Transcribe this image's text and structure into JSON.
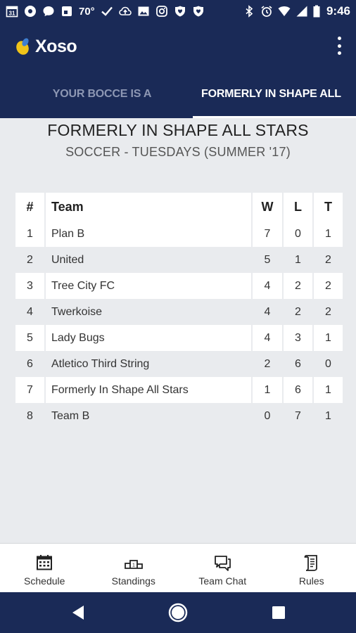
{
  "status_bar": {
    "temperature": "70°",
    "calendar_day": "31",
    "time": "9:46"
  },
  "app": {
    "name": "Xoso",
    "colors": {
      "primary": "#1a2a57",
      "logo_accent": "#f0c419",
      "background": "#e9ebee"
    }
  },
  "tabs": [
    {
      "label": "YOUR BOCCE IS A",
      "active": false
    },
    {
      "label": "FORMERLY IN SHAPE ALL",
      "active": true
    }
  ],
  "page": {
    "title": "FORMERLY IN SHAPE ALL STARS",
    "subtitle": "SOCCER - TUESDAYS (SUMMER '17)"
  },
  "standings": {
    "headers": [
      "#",
      "Team",
      "W",
      "L",
      "T"
    ],
    "rows": [
      {
        "rank": "1",
        "team": "Plan B",
        "w": "7",
        "l": "0",
        "t": "1"
      },
      {
        "rank": "2",
        "team": "United",
        "w": "5",
        "l": "1",
        "t": "2"
      },
      {
        "rank": "3",
        "team": "Tree City FC",
        "w": "4",
        "l": "2",
        "t": "2"
      },
      {
        "rank": "4",
        "team": "Twerkoise",
        "w": "4",
        "l": "2",
        "t": "2"
      },
      {
        "rank": "5",
        "team": "Lady Bugs",
        "w": "4",
        "l": "3",
        "t": "1"
      },
      {
        "rank": "6",
        "team": "Atletico Third String",
        "w": "2",
        "l": "6",
        "t": "0"
      },
      {
        "rank": "7",
        "team": "Formerly In Shape All Stars",
        "w": "1",
        "l": "6",
        "t": "1"
      },
      {
        "rank": "8",
        "team": "Team B",
        "w": "0",
        "l": "7",
        "t": "1"
      }
    ]
  },
  "bottom_nav": [
    {
      "label": "Schedule",
      "icon": "calendar-icon"
    },
    {
      "label": "Standings",
      "icon": "podium-icon"
    },
    {
      "label": "Team Chat",
      "icon": "chat-icon"
    },
    {
      "label": "Rules",
      "icon": "document-icon"
    }
  ],
  "system_nav": [
    "back-icon",
    "home-icon",
    "recents-icon"
  ]
}
